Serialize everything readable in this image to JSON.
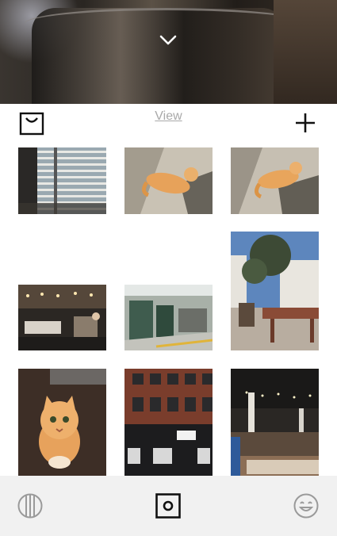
{
  "toolbar": {
    "view_label": "View"
  },
  "icons": {
    "collapse": "chevron-down-icon",
    "shop": "shopping-bag-icon",
    "add": "plus-icon",
    "library": "grid-lines-icon",
    "camera": "camera-icon",
    "profile": "smiley-icon"
  },
  "colors": {
    "link_gray": "#a9a9a9",
    "icon_dark": "#111111",
    "icon_gray": "#9a9a9a",
    "tabbar_bg": "#f1f1f1"
  },
  "photos": [
    {
      "subject": "window-blinds"
    },
    {
      "subject": "orange-cat-lying"
    },
    {
      "subject": "orange-cat-lying"
    },
    {
      "subject": "lounge-interior"
    },
    {
      "subject": "industrial-workshop"
    },
    {
      "subject": "patio-with-tree"
    },
    {
      "subject": "orange-cat-looking-up"
    },
    {
      "subject": "brick-building"
    },
    {
      "subject": "loft-interior"
    }
  ]
}
